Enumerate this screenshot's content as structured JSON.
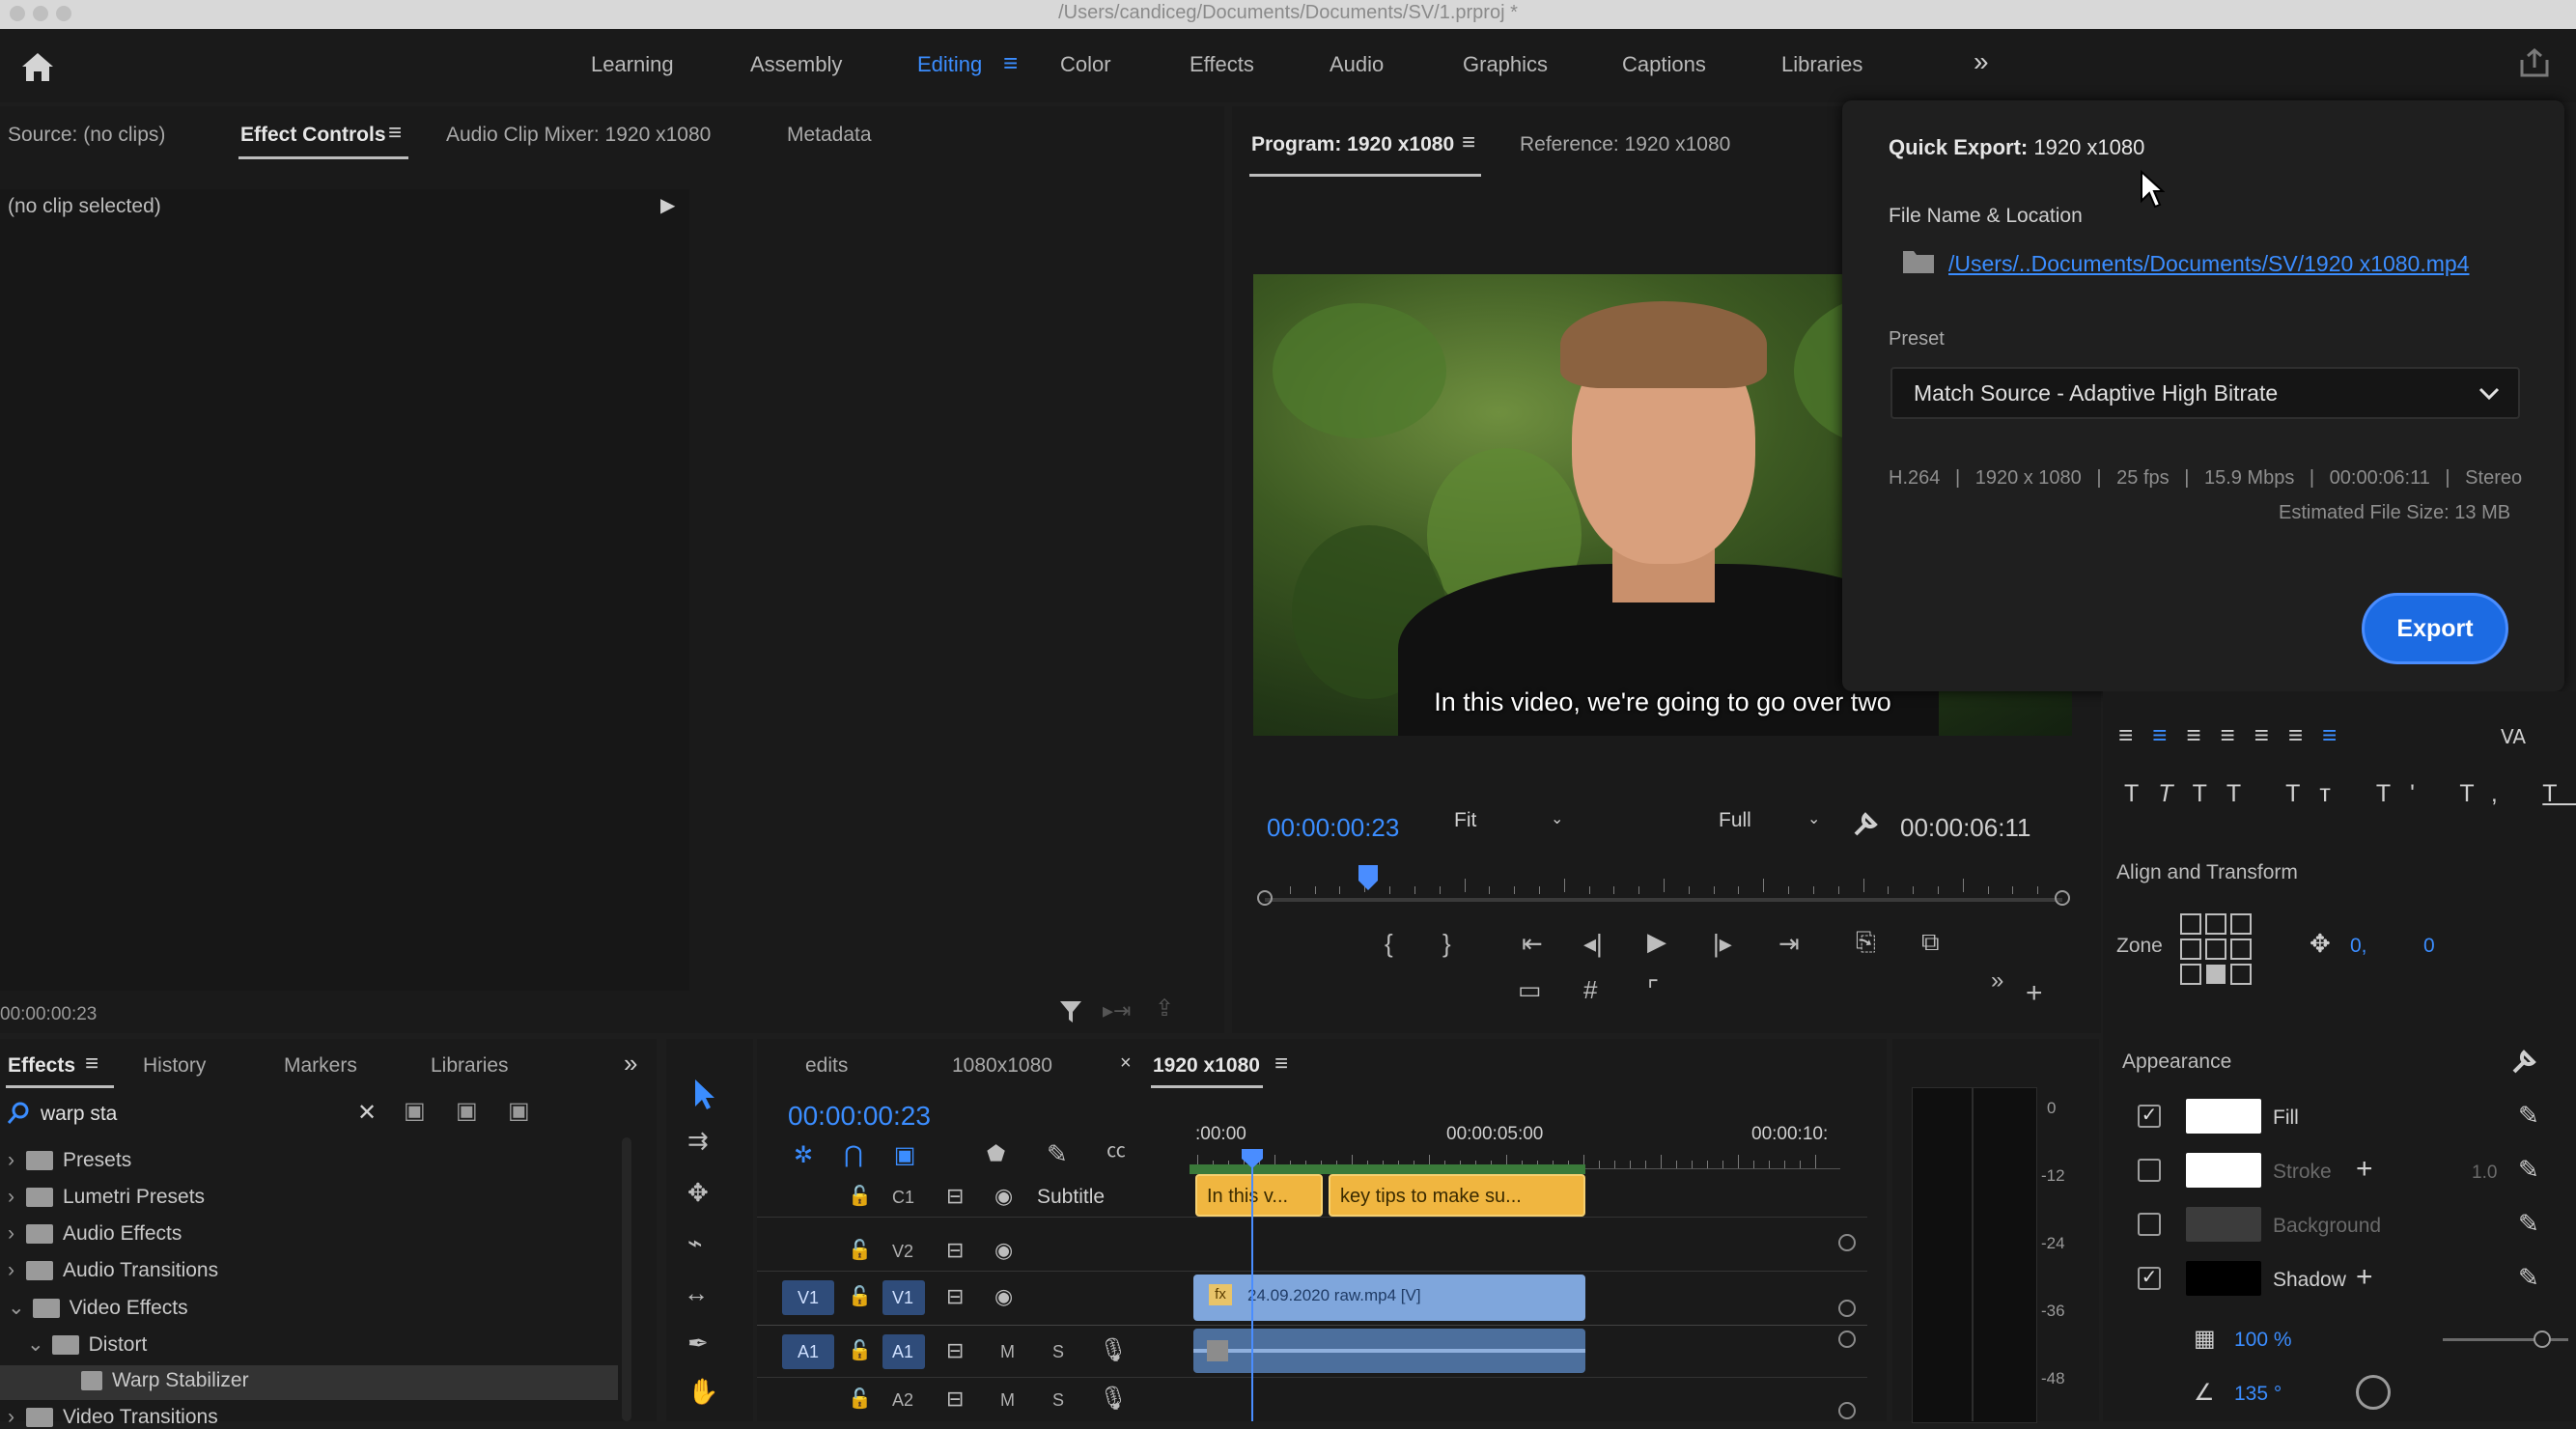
{
  "window": {
    "title": "/Users/candiceg/Documents/Documents/SV/1.prproj *"
  },
  "workspaces": {
    "tabs": [
      "Learning",
      "Assembly",
      "Editing",
      "Color",
      "Effects",
      "Audio",
      "Graphics",
      "Captions",
      "Libraries"
    ],
    "active": "Editing"
  },
  "source_panel": {
    "tabs": [
      "Source: (no clips)",
      "Effect Controls",
      "Audio Clip Mixer: 1920 x1080",
      "Metadata"
    ],
    "active": "Effect Controls",
    "no_clip": "(no clip selected)",
    "timecode": "00:00:00:23"
  },
  "program": {
    "tabs": [
      "Program: 1920 x1080",
      "Reference: 1920 x1080"
    ],
    "subtitle": "In this video, we're going to go over two",
    "current_time": "00:00:00:23",
    "fit": "Fit",
    "quality": "Full",
    "duration": "00:00:06:11",
    "playhead_fraction": 0.13
  },
  "quick_export": {
    "title_bold": "Quick Export:",
    "title_rest": "1920 x1080",
    "file_label": "File Name & Location",
    "file_path": "/Users/..Documents/Documents/SV/1920 x1080.mp4",
    "preset_label": "Preset",
    "preset_value": "Match Source - Adaptive High Bitrate",
    "specs": [
      "H.264",
      "1920 x 1080",
      "25 fps",
      "15.9 Mbps",
      "00:00:06:11",
      "Stereo"
    ],
    "file_size": "Estimated File Size: 13 MB",
    "export_label": "Export"
  },
  "effects_panel": {
    "tabs": [
      "Effects",
      "History",
      "Markers",
      "Libraries"
    ],
    "active": "Effects",
    "search_value": "warp sta",
    "tree": [
      {
        "label": "Presets",
        "expanded": false,
        "depth": 0
      },
      {
        "label": "Lumetri Presets",
        "expanded": false,
        "depth": 0
      },
      {
        "label": "Audio Effects",
        "expanded": false,
        "depth": 0
      },
      {
        "label": "Audio Transitions",
        "expanded": false,
        "depth": 0
      },
      {
        "label": "Video Effects",
        "expanded": true,
        "depth": 0
      },
      {
        "label": "Distort",
        "expanded": true,
        "depth": 1
      },
      {
        "label": "Warp Stabilizer",
        "expanded": false,
        "depth": 2
      },
      {
        "label": "Video Transitions",
        "expanded": false,
        "depth": 0
      }
    ]
  },
  "timeline": {
    "tabs": [
      "edits",
      "1080x1080",
      "1920 x1080"
    ],
    "active": "1920 x1080",
    "timecode": "00:00:00:23",
    "ruler": [
      ":00:00",
      "00:00:05:00",
      "00:00:10:"
    ],
    "tracks": {
      "subtitle": {
        "name": "C1",
        "label": "Subtitle"
      },
      "v2": {
        "name": "V2"
      },
      "v1": {
        "source": "V1",
        "name": "V1"
      },
      "a1": {
        "source": "A1",
        "name": "A1",
        "m": "M",
        "s": "S"
      },
      "a2": {
        "name": "A2",
        "m": "M",
        "s": "S"
      }
    },
    "clips": {
      "caption1": "In this v...",
      "caption2": "key tips to make su...",
      "video": "24.09.2020 raw.mp4 [V]",
      "fx": "fx"
    }
  },
  "meter": {
    "ticks": [
      "0",
      "-12",
      "-24",
      "-36",
      "-48"
    ]
  },
  "essential_graphics": {
    "align_label": "Align and Transform",
    "zone_label": "Zone",
    "pos_x": "0,",
    "pos_y": "0",
    "appearance_label": "Appearance",
    "rows": [
      {
        "label": "Fill",
        "checked": true,
        "color": "#ffffff"
      },
      {
        "label": "Stroke",
        "checked": false,
        "color": "#ffffff",
        "value": "1.0"
      },
      {
        "label": "Background",
        "checked": false,
        "color": "#3c3c3c"
      },
      {
        "label": "Shadow",
        "checked": true,
        "color": "#000000"
      }
    ],
    "opacity": "100 %",
    "angle": "135 °"
  },
  "colors": {
    "accent": "#3b8dff",
    "export": "#1c6be3",
    "caption_clip": "#f0b640",
    "video_clip": "#7fa6dc",
    "audio_clip": "#4c6f9d"
  }
}
